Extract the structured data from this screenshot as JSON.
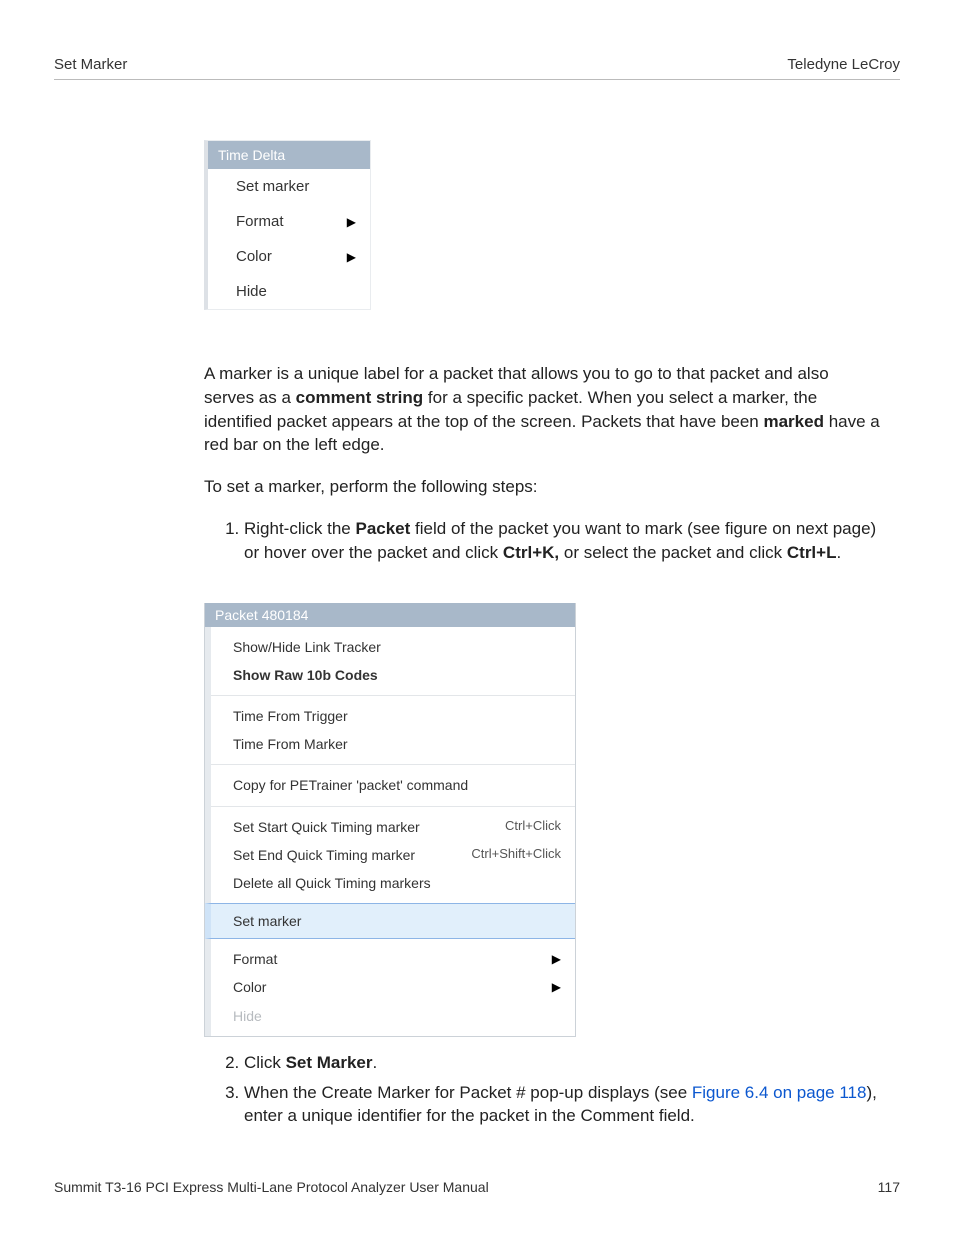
{
  "header": {
    "left": "Set Marker",
    "right": "Teledyne LeCroy"
  },
  "menu1": {
    "title": "Time Delta",
    "items": [
      {
        "label": "Set marker",
        "submenu": false
      },
      {
        "label": "Format",
        "submenu": true
      },
      {
        "label": "Color",
        "submenu": true
      },
      {
        "label": "Hide",
        "submenu": false
      }
    ]
  },
  "paragraphs": {
    "intro_a": "A marker is a unique label for a packet that allows you to go to that packet and also serves as a ",
    "intro_bold1": "comment string",
    "intro_b": " for a specific packet. When you select a marker, the identified packet appears at the top of the screen. Packets that have been ",
    "intro_bold2": "marked",
    "intro_c": " have a red bar on the left edge.",
    "lead": "To set a marker, perform the following steps:"
  },
  "steps": {
    "s1a": "Right-click the ",
    "s1_bold1": "Packet",
    "s1b": " field of the packet you want to mark (see figure on next page) or hover over the packet and click ",
    "s1_bold2": "Ctrl+K,",
    "s1c": " or select the packet and click ",
    "s1_bold3": "Ctrl+L",
    "s1d": ".",
    "s2a": "Click ",
    "s2_bold": "Set Marker",
    "s2b": ".",
    "s3a": "When the Create Marker for Packet # pop-up displays (see ",
    "s3_link": "Figure 6.4 on page 118",
    "s3b": "), enter a unique identifier for the packet in the Comment field."
  },
  "menu2": {
    "title": "Packet 480184",
    "group1": [
      {
        "label": "Show/Hide Link Tracker",
        "bold": false
      },
      {
        "label": "Show Raw 10b Codes",
        "bold": true
      }
    ],
    "group2": [
      {
        "label": "Time From Trigger"
      },
      {
        "label": "Time From Marker"
      }
    ],
    "group3": [
      {
        "label": "Copy for PETrainer 'packet' command"
      }
    ],
    "group4": [
      {
        "label": "Set Start Quick Timing marker",
        "shortcut": "Ctrl+Click"
      },
      {
        "label": "Set End Quick Timing marker",
        "shortcut": "Ctrl+Shift+Click"
      },
      {
        "label": "Delete all Quick Timing markers",
        "shortcut": ""
      }
    ],
    "highlight": {
      "label": "Set marker"
    },
    "group5": [
      {
        "label": "Format",
        "submenu": true,
        "disabled": false
      },
      {
        "label": "Color",
        "submenu": true,
        "disabled": false
      },
      {
        "label": "Hide",
        "submenu": false,
        "disabled": true
      }
    ]
  },
  "footer": {
    "left": "Summit T3-16 PCI Express Multi-Lane Protocol Analyzer User Manual",
    "right": "117"
  }
}
